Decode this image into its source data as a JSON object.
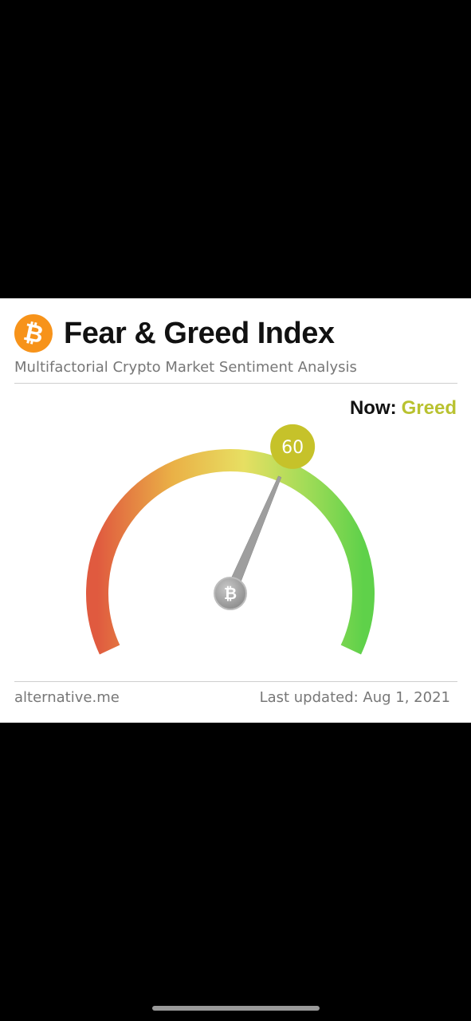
{
  "card": {
    "title": "Fear & Greed Index",
    "subtitle": "Multifactorial Crypto Market Sentiment Analysis",
    "logo_icon": "bitcoin-icon",
    "now_label": "Now:",
    "now_value": "Greed",
    "source": "alternative.me",
    "last_updated": "Last updated: Aug 1, 2021"
  },
  "gauge": {
    "value": "60",
    "value_number": 60,
    "min": 0,
    "max": 100,
    "value_badge_color": "#c6c22a",
    "gradient_colors": [
      "#e05a3f",
      "#eab046",
      "#e7df62",
      "#9fdc57",
      "#5fd14a"
    ],
    "needle_color": "#9e9e9e",
    "hub_icon": "bitcoin-icon"
  },
  "colors": {
    "brand_orange": "#f7931a",
    "greed": "#b9c230"
  }
}
